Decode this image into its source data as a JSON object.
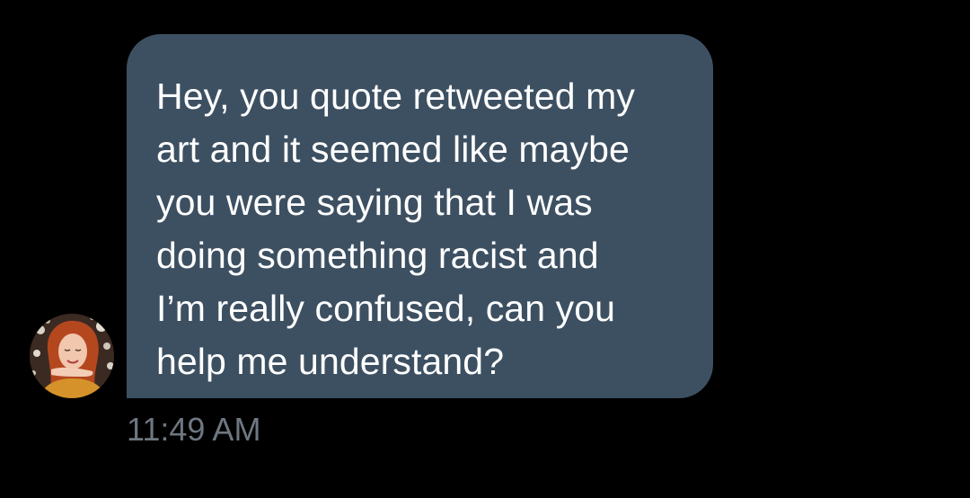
{
  "message": {
    "text": "Hey, you quote retweeted my\nart and it seemed like maybe\nyou were saying that I was\ndoing something racist and\nI’m really confused, can you\nhelp me understand?",
    "timestamp": "11:49 AM"
  },
  "colors": {
    "background": "#000000",
    "bubble": "#3d5062",
    "message_text": "#ffffff",
    "timestamp_text": "#6e7781"
  },
  "avatar": {
    "icon": "sender-avatar-photo"
  }
}
